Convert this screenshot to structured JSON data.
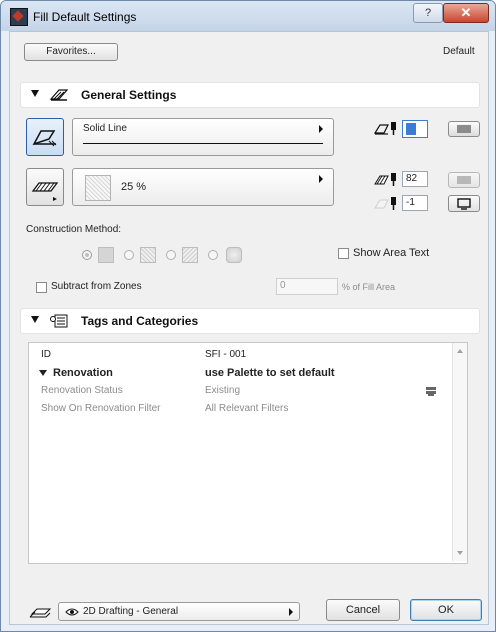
{
  "window": {
    "title": "Fill Default Settings",
    "help_glyph": "?",
    "close_glyph": "✕"
  },
  "top": {
    "favorites_label": "Favorites...",
    "default_label": "Default"
  },
  "general": {
    "title": "General Settings",
    "line_type": "Solid Line",
    "pen_value": "2",
    "fill_percent": "25 %",
    "pen_fg": "82",
    "pen_bg": "-1",
    "construction_method_label": "Construction Method:",
    "show_area_text_label": "Show Area Text",
    "subtract_zones_label": "Subtract from Zones",
    "fill_area_value": "0",
    "fill_area_suffix": "% of Fill Area"
  },
  "tags": {
    "title": "Tags and Categories",
    "rows": [
      {
        "name": "ID",
        "value": "SFI - 001"
      },
      {
        "name": "Renovation",
        "value": "use Palette to set default"
      },
      {
        "name": "Renovation Status",
        "value": "Existing"
      },
      {
        "name": "Show On Renovation Filter",
        "value": "All Relevant Filters"
      }
    ]
  },
  "footer": {
    "layer_label": "2D Drafting - General",
    "cancel_label": "Cancel",
    "ok_label": "OK"
  },
  "colors": {
    "accent_field": "#3d7bd6",
    "section_bg": "#ffffff",
    "title_bar": "#c4d4e8"
  }
}
